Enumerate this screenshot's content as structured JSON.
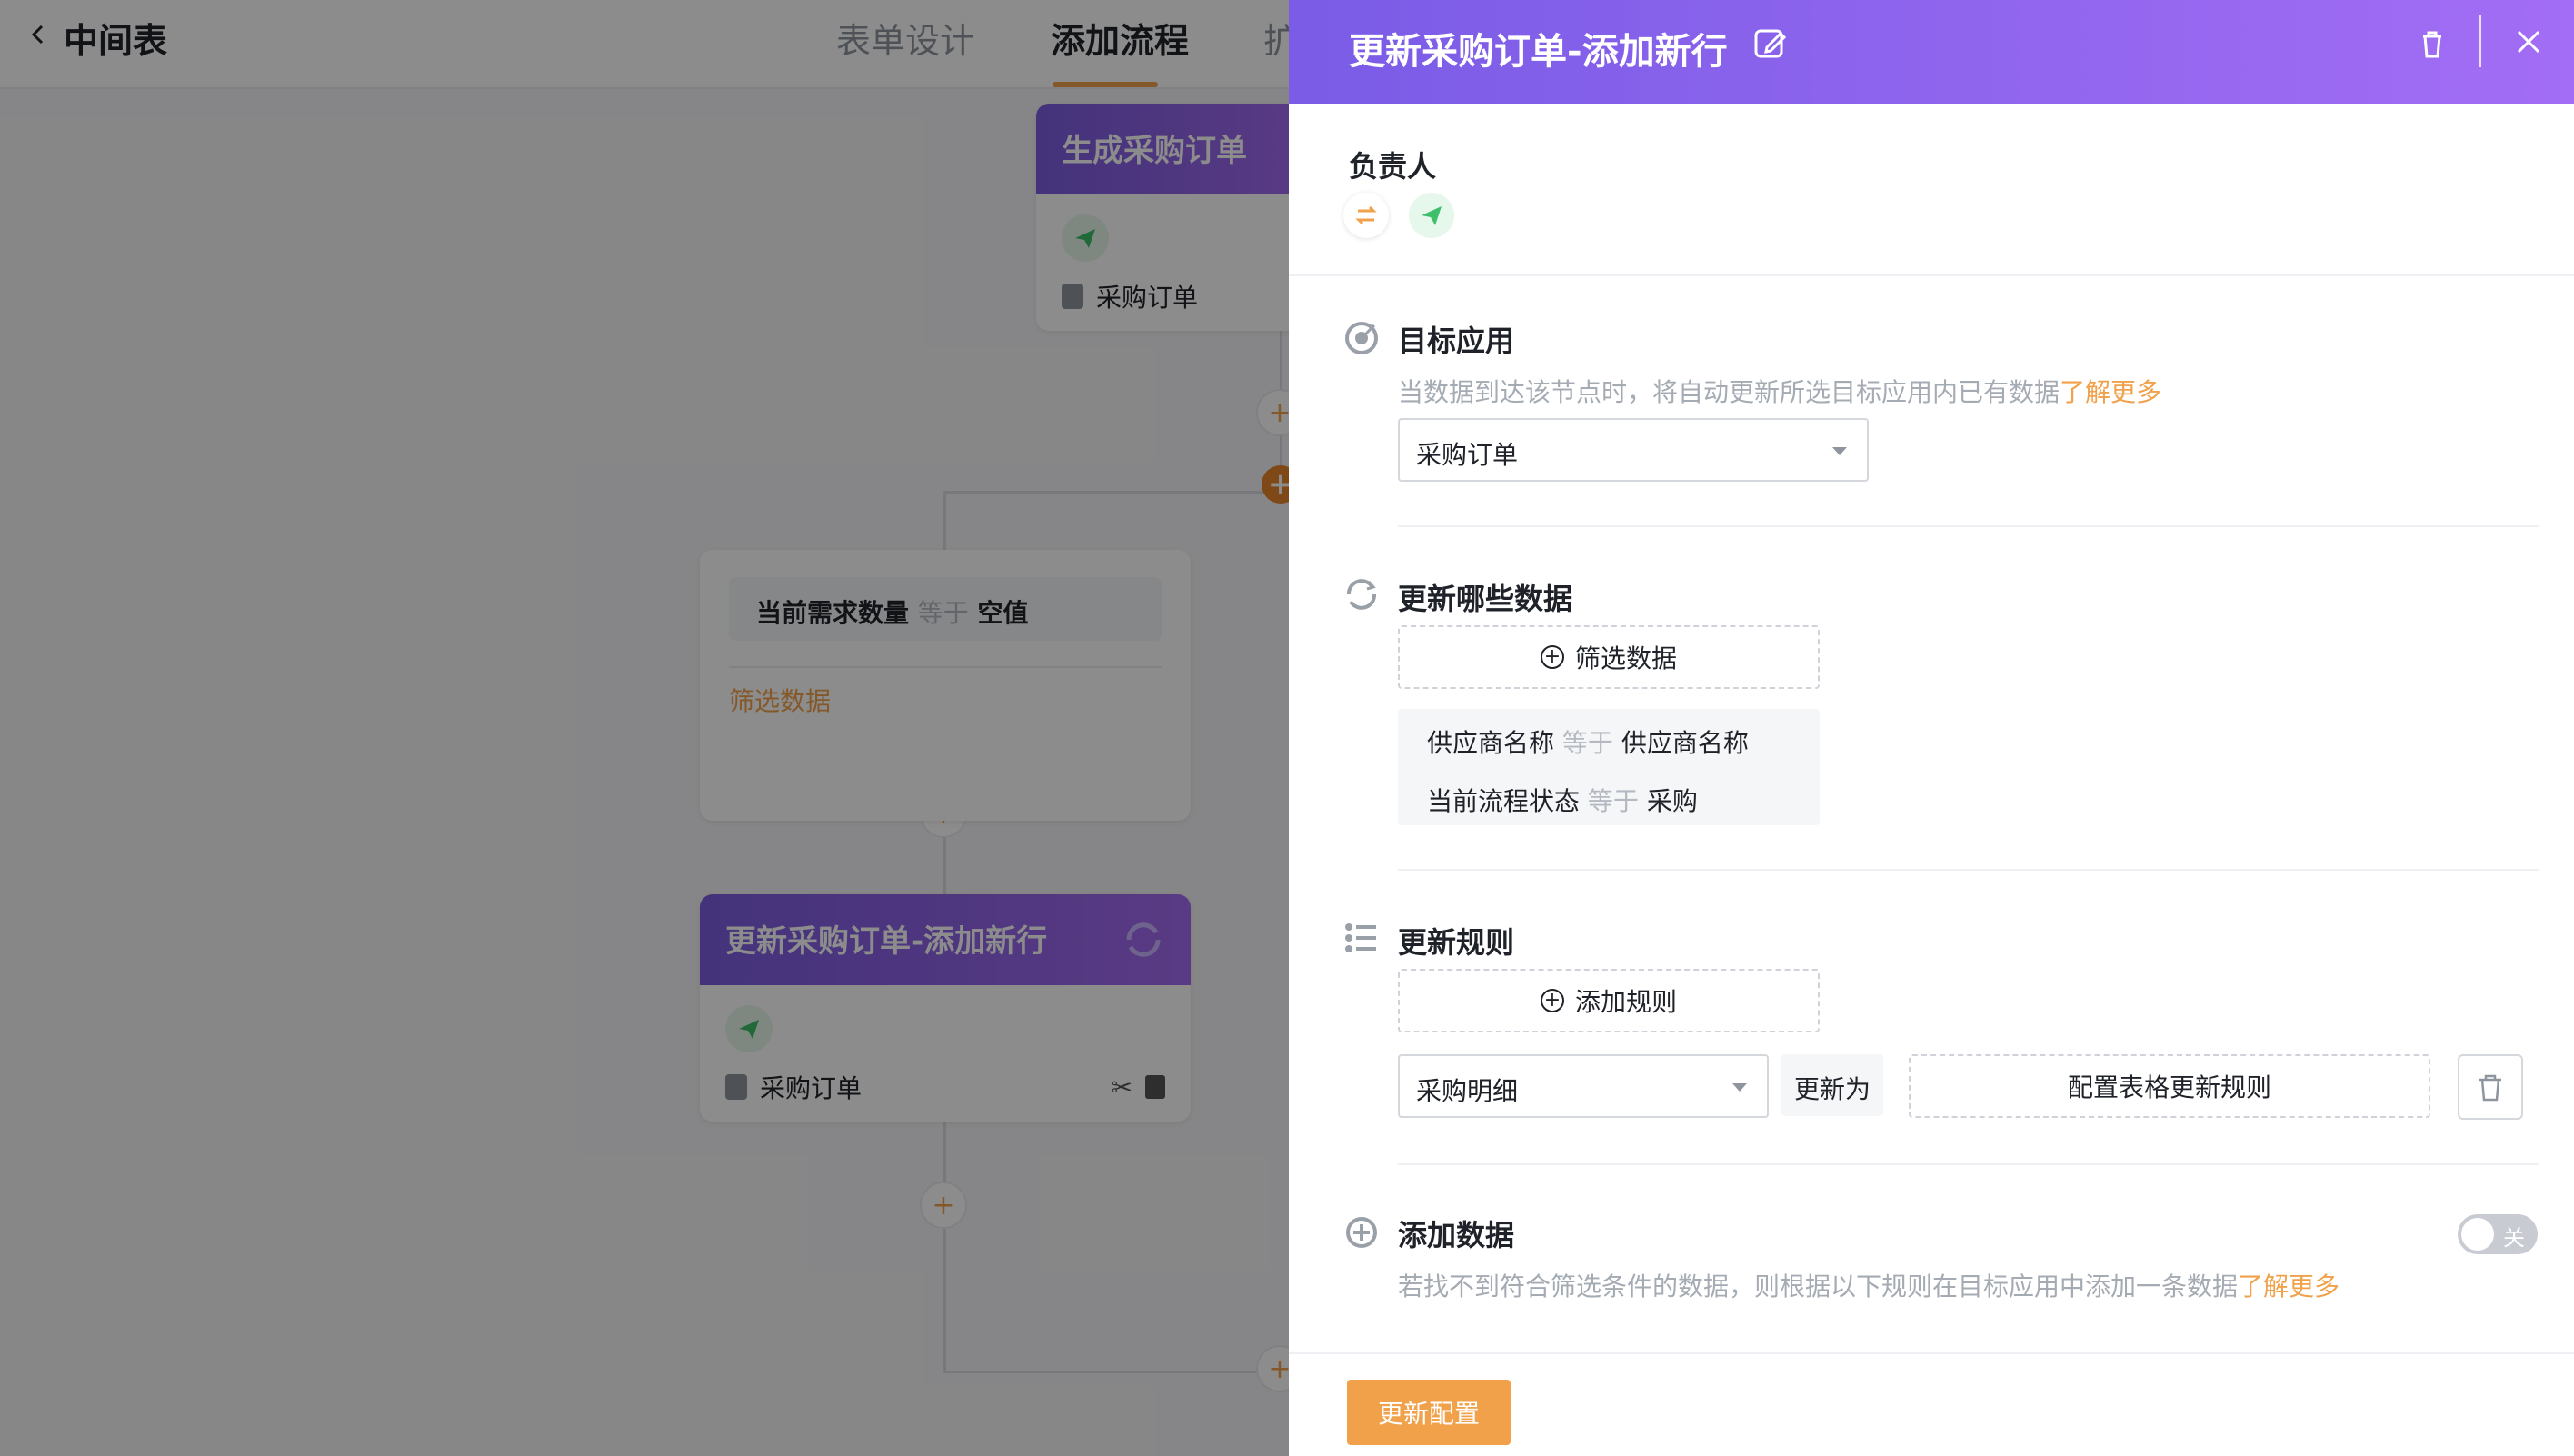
{
  "background": {
    "app_title": "中间表",
    "tabs": [
      "表单设计",
      "添加流程",
      "扩"
    ],
    "nodes": {
      "top_title": "生成采购订单",
      "top_form": "采购订单",
      "condition": {
        "field": "当前需求数量",
        "op": "等于",
        "value": "空值",
        "link": "筛选数据"
      },
      "update_title": "更新采购订单-添加新行",
      "update_form": "采购订单"
    }
  },
  "drawer": {
    "title": "更新采购订单-添加新行",
    "owner_label": "负责人",
    "target": {
      "title": "目标应用",
      "desc": "当数据到达该节点时，将自动更新所选目标应用内已有数据",
      "learn_more": "了解更多",
      "selected": "采购订单"
    },
    "which_data": {
      "title": "更新哪些数据",
      "filter_button": "筛选数据",
      "filters": [
        {
          "field": "供应商名称",
          "op": "等于",
          "value": "供应商名称"
        },
        {
          "field": "当前流程状态",
          "op": "等于",
          "value": "采购"
        }
      ]
    },
    "rules": {
      "title": "更新规则",
      "add_button": "添加规则",
      "rule_field": "采购明细",
      "rule_tag": "更新为",
      "rule_config": "配置表格更新规则"
    },
    "add_data": {
      "title": "添加数据",
      "desc": "若找不到符合筛选条件的数据，则根据以下规则在目标应用中添加一条数据",
      "learn_more": "了解更多",
      "toggle_text": "关",
      "toggle_on": false
    },
    "submit": "更新配置"
  },
  "colors": {
    "accent": "#f0a14a",
    "header_gradient_start": "#7a5ce6",
    "header_gradient_end": "#a36df5"
  }
}
